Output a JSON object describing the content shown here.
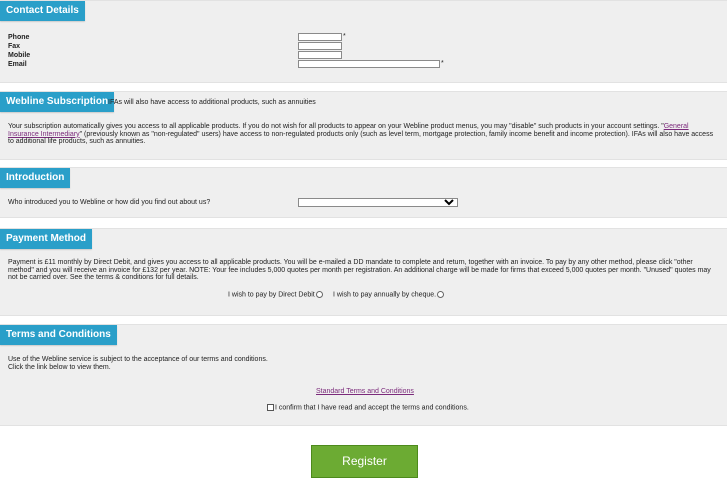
{
  "contact": {
    "title": "Contact Details",
    "phone_label": "Phone",
    "fax_label": "Fax",
    "mobile_label": "Mobile",
    "email_label": "Email",
    "required_marker": "*"
  },
  "subscription": {
    "title": "Webline Subscription",
    "header_note": "IFAs will also have access to additional products, such as annuities",
    "body_part1": "Your subscription automatically gives you access to all applicable products. If you do not wish for all products to appear on your Webline product menus, you may \"disable\" such products in your account settings. \"",
    "link_text": "General Insurance Intermediary",
    "body_part2": "\" (previously known as \"non-regulated\" users) have access to non-regulated products only (such as level term, mortgage protection, family income benefit and income protection). IFAs will also have access to additional life products, such as annuities."
  },
  "introduction": {
    "title": "Introduction",
    "question": "Who introduced you to Webline or how did you find out about us?",
    "selected_value": ""
  },
  "payment": {
    "title": "Payment Method",
    "body": "Payment is £11 monthly by Direct Debit, and gives you access to all applicable products. You will be e-mailed a DD mandate to complete and return, together with an invoice. To pay by any other method, please click \"other method\" and you will receive an invoice for £132 per year. NOTE: Your fee includes 5,000 quotes per month per registration. An additional charge will be made for firms that exceed 5,000 quotes per month. \"Unused\" quotes may not be carried over. See the terms & conditions for full details.",
    "option_dd": "I wish to pay by Direct Debit",
    "option_cheque": "I wish to pay annually by cheque."
  },
  "terms": {
    "title": "Terms and Conditions",
    "line1": "Use of the Webline service is subject to the acceptance of our terms and conditions.",
    "line2": "Click the link below to view them.",
    "link_text": "Standard Terms and Conditions",
    "confirm_text": "I confirm that I have read and accept the terms and conditions."
  },
  "register_label": "Register"
}
